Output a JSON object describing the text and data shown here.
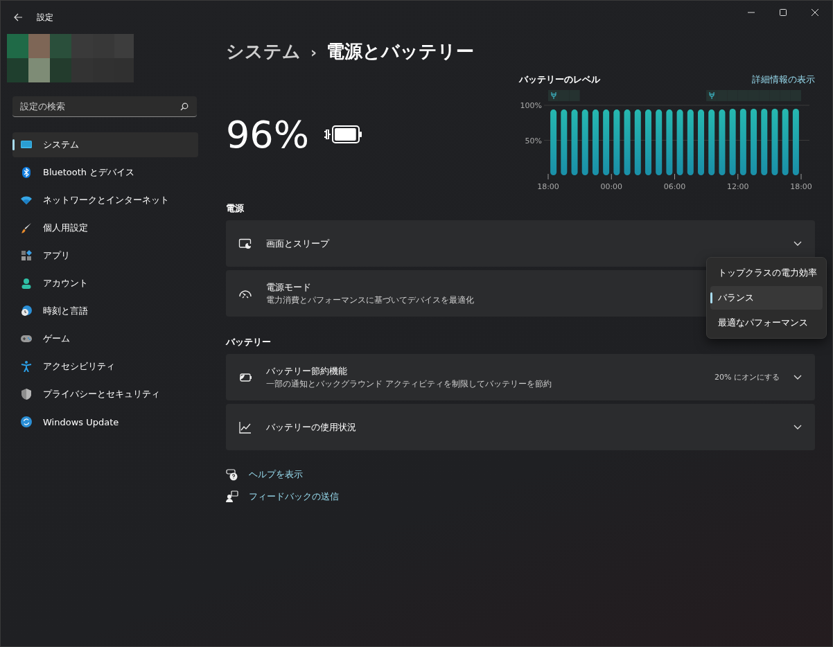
{
  "window": {
    "title": "設定"
  },
  "search": {
    "placeholder": "設定の検索"
  },
  "sidebar": {
    "items": [
      {
        "label": "システム",
        "kind": "system",
        "selected": true
      },
      {
        "label": "Bluetooth とデバイス",
        "kind": "bluetooth",
        "selected": false
      },
      {
        "label": "ネットワークとインターネット",
        "kind": "network",
        "selected": false
      },
      {
        "label": "個人用設定",
        "kind": "personalize",
        "selected": false
      },
      {
        "label": "アプリ",
        "kind": "apps",
        "selected": false
      },
      {
        "label": "アカウント",
        "kind": "account",
        "selected": false
      },
      {
        "label": "時刻と言語",
        "kind": "time",
        "selected": false
      },
      {
        "label": "ゲーム",
        "kind": "game",
        "selected": false
      },
      {
        "label": "アクセシビリティ",
        "kind": "accessibility",
        "selected": false
      },
      {
        "label": "プライバシーとセキュリティ",
        "kind": "privacy",
        "selected": false
      },
      {
        "label": "Windows Update",
        "kind": "update",
        "selected": false
      }
    ]
  },
  "breadcrumb": {
    "parent": "システム",
    "separator": "›",
    "current": "電源とバッテリー"
  },
  "battery": {
    "percent": "96%",
    "charging": true,
    "level": 0.96
  },
  "battery_chart": {
    "title": "バッテリーのレベル",
    "link": "詳細情報の表示",
    "chart_data": {
      "type": "bar",
      "categories": [
        "18:00",
        null,
        null,
        null,
        null,
        null,
        "00:00",
        null,
        null,
        null,
        null,
        null,
        "06:00",
        null,
        null,
        null,
        null,
        null,
        "12:00",
        null,
        null,
        null,
        null,
        null
      ],
      "values": [
        94,
        94,
        94,
        94,
        94,
        94,
        94,
        94,
        94,
        94,
        94,
        94,
        94,
        94,
        94,
        94,
        94,
        95,
        95,
        95,
        95,
        95,
        95,
        95
      ],
      "ylim": [
        0,
        100
      ],
      "yticks": [
        {
          "value": 50,
          "label": "50%"
        },
        {
          "value": 100,
          "label": "100%"
        }
      ],
      "stacked": false
    },
    "axis_end_label": "18:00",
    "charging": [
      true,
      true,
      true,
      false,
      false,
      false,
      false,
      false,
      false,
      false,
      false,
      false,
      false,
      false,
      false,
      true,
      true,
      true,
      true,
      true,
      true,
      true,
      true,
      true
    ]
  },
  "sections": [
    {
      "heading": "電源",
      "rows": [
        {
          "kind": "display",
          "title": "画面とスリープ",
          "chevron": true
        },
        {
          "kind": "powermode",
          "title": "電源モード",
          "description": "電力消費とパフォーマンスに基づいてデバイスを最適化",
          "chevron": false
        }
      ]
    },
    {
      "heading": "バッテリー",
      "rows": [
        {
          "kind": "saver",
          "title": "バッテリー節約機能",
          "description": "一部の通知とバックグラウンド アクティビティを制限してバッテリーを節約",
          "value": "20% にオンにする",
          "chevron": true
        },
        {
          "kind": "usage",
          "title": "バッテリーの使用状況",
          "chevron": true
        }
      ]
    }
  ],
  "power_mode_menu": {
    "items": [
      {
        "label": "トップクラスの電力効率",
        "selected": false
      },
      {
        "label": "バランス",
        "selected": true
      },
      {
        "label": "最適なパフォーマンス",
        "selected": false
      }
    ]
  },
  "links": [
    {
      "label": "ヘルプを表示",
      "kind": "help"
    },
    {
      "label": "フィードバックの送信",
      "kind": "feedback"
    }
  ]
}
